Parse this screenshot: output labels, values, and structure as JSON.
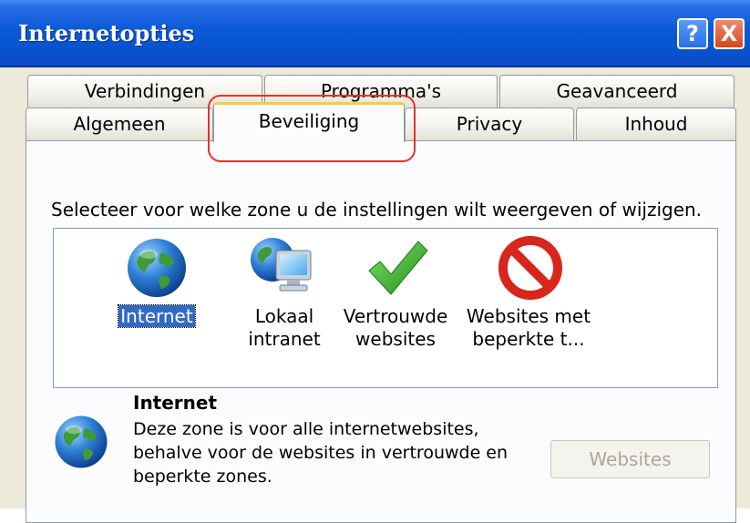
{
  "window": {
    "title": "Internetopties"
  },
  "titlebar_buttons": {
    "help": "?",
    "close": "X"
  },
  "tabs": {
    "row1": [
      "Verbindingen",
      "Programma's",
      "Geavanceerd"
    ],
    "row2": [
      "Algemeen",
      "Beveiliging",
      "Privacy",
      "Inhoud"
    ],
    "active": "Beveiliging"
  },
  "security": {
    "instruction": "Selecteer voor welke zone u de instellingen wilt weergeven of wijzigen.",
    "zones": [
      {
        "label": "Internet",
        "icon": "globe-icon",
        "selected": true
      },
      {
        "label": "Lokaal intranet",
        "icon": "computer-globe-icon"
      },
      {
        "label": "Vertrouwde websites",
        "label_lines": [
          "Vertrouwde",
          "websites"
        ],
        "icon": "checkmark-icon"
      },
      {
        "label": "Websites met beperkte t...",
        "label_lines": [
          "Websites met",
          "beperkte t..."
        ],
        "icon": "no-entry-icon"
      }
    ],
    "info": {
      "title": "Internet",
      "description": "Deze zone is voor alle internetwebsites, behalve voor de websites in vertrouwde en beperkte zones.",
      "description_lines": [
        "Deze zone is voor alle internetwebsites,",
        "behalve voor de websites in vertrouwde en",
        "beperkte zones."
      ],
      "button": "Websites",
      "button_enabled": false
    }
  },
  "colors": {
    "titlebar": "#0a5ad8",
    "selection": "#316ac5",
    "active_tab_accent": "#ffc83c",
    "annotation": "#e5322d"
  }
}
